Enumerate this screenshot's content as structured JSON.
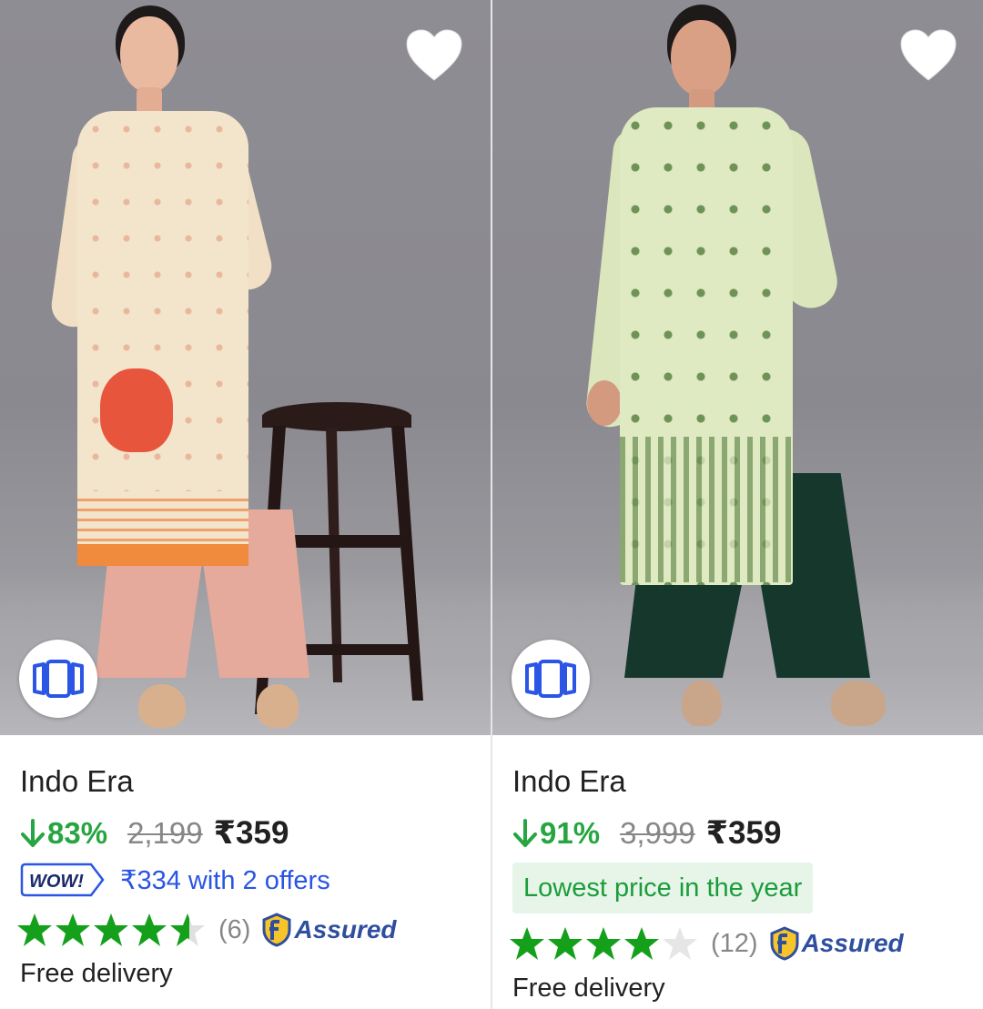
{
  "products": [
    {
      "brand": "Indo Era",
      "discount": "83%",
      "mrp": "2,199",
      "price": "₹359",
      "offer": {
        "badge": "WOW!",
        "text": "₹334 with 2 offers"
      },
      "rating": {
        "stars": 4.5,
        "count": "(6)"
      },
      "assured": "Assured",
      "delivery": "Free delivery",
      "colors": {
        "kurta": "#f3e4cc",
        "kurta_border": "#f08a3c",
        "pants": "#e3a89a"
      }
    },
    {
      "brand": "Indo Era",
      "discount": "91%",
      "mrp": "3,999",
      "price": "₹359",
      "highlight": "Lowest price in the year",
      "rating": {
        "stars": 4,
        "count": "(12)"
      },
      "assured": "Assured",
      "delivery": "Free delivery",
      "colors": {
        "kurta": "#dfe9c2",
        "kurta_print": "#5c7f46",
        "pants": "#16372c"
      }
    }
  ],
  "icons": {
    "wishlist": "heart-icon",
    "similar": "cards-icon",
    "discount": "arrow-down-icon",
    "rating": "star-icon",
    "assured": "flipkart-assured-icon"
  },
  "theme": {
    "discount_green": "#26a541",
    "star_green": "#14a01a",
    "offer_blue": "#2a55e5",
    "assured_blue": "#2f4f9e",
    "muted": "#878787"
  }
}
